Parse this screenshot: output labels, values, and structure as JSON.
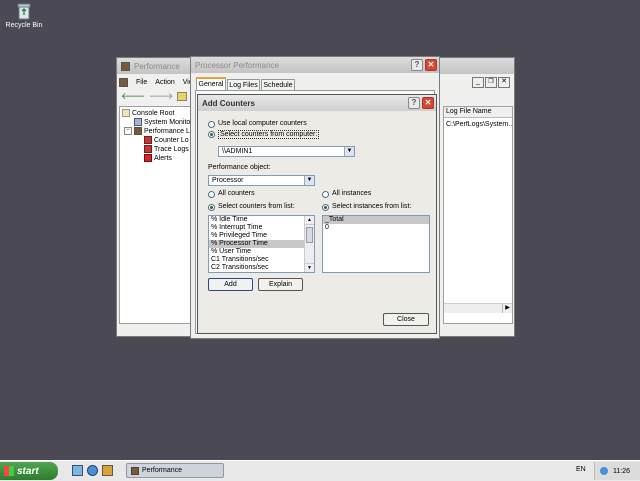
{
  "desktop": {
    "recycle_bin_label": "Recycle Bin"
  },
  "perf_window": {
    "title": "Performance",
    "menu": [
      "File",
      "Action",
      "View"
    ],
    "tree": {
      "console_root": "Console Root",
      "system_monitor": "System Monitor",
      "perf_logs": "Performance Lo",
      "counter_logs": "Counter Lo",
      "trace_logs": "Trace Logs",
      "alerts": "Alerts"
    },
    "right_column_header": "Log File Name",
    "right_column_value": "C:\\PerfLogs\\System..."
  },
  "proc_dialog": {
    "title": "Processor Performance",
    "tabs": [
      "General",
      "Log Files",
      "Schedule"
    ]
  },
  "add_counters": {
    "title": "Add Counters",
    "use_local_label": "Use local computer counters",
    "select_computer_label": "Select counters from computer:",
    "computer_value": "\\\\ADMIN1",
    "perf_object_label": "Performance object:",
    "perf_object_value": "Processor",
    "all_counters_label": "All counters",
    "select_counters_label": "Select counters from list:",
    "counters": [
      "% Idle Time",
      "% Interrupt Time",
      "% Privileged Time",
      "% Processor Time",
      "% User Time",
      "C1 Transitions/sec",
      "C2 Transitions/sec"
    ],
    "selected_counter": "% Processor Time",
    "all_instances_label": "All instances",
    "select_instances_label": "Select instances from list:",
    "instances": [
      "_Total",
      "0"
    ],
    "add_label": "Add",
    "explain_label": "Explain",
    "close_label": "Close"
  },
  "taskbar": {
    "start_label": "start",
    "task_label": "Performance",
    "lang": "EN",
    "clock": "11:26"
  }
}
